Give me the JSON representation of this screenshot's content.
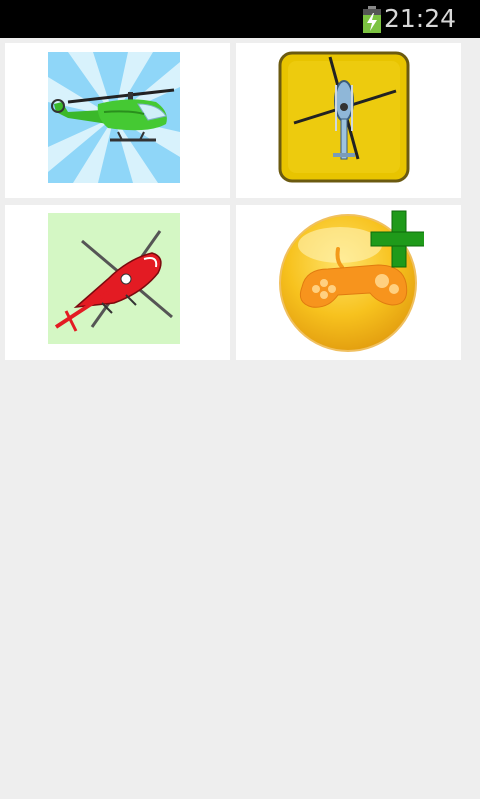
{
  "status_bar": {
    "time": "21:24",
    "battery_icon": "battery-charging-icon"
  },
  "game_grid": {
    "tiles": [
      {
        "icon": "green-helicopter-icon"
      },
      {
        "icon": "blue-helicopter-topdown-icon"
      },
      {
        "icon": "red-helicopter-icon"
      },
      {
        "icon": "add-game-icon"
      }
    ]
  },
  "colors": {
    "background": "#eeeeee",
    "tile": "#ffffff",
    "status_bar": "#000000",
    "battery_fill": "#7cc341"
  }
}
